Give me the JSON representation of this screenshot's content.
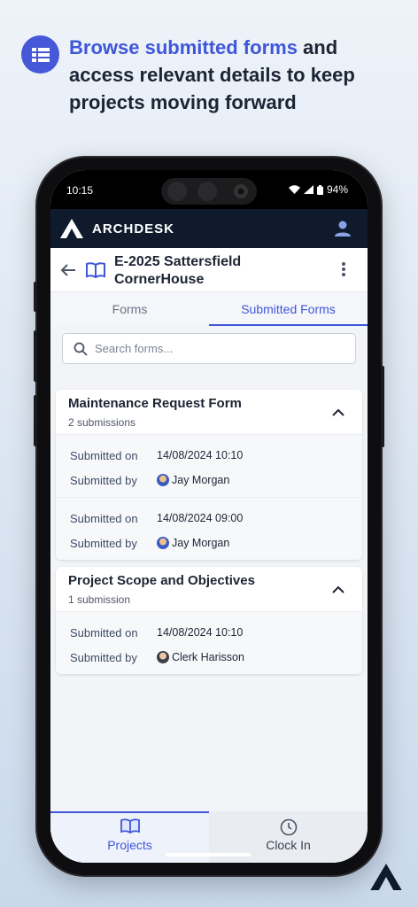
{
  "promo": {
    "headline_highlight": "Browse submitted forms",
    "headline_rest": " and access relevant details to keep projects moving forward",
    "icon": "list-icon"
  },
  "status_bar": {
    "time": "10:15",
    "battery": "94%"
  },
  "app": {
    "brand": "ARCHDESK"
  },
  "project": {
    "title_line1": "E-2025 Sattersfield",
    "title_line2": "CornerHouse"
  },
  "tabs": [
    {
      "label": "Forms",
      "active": false
    },
    {
      "label": "Submitted Forms",
      "active": true
    }
  ],
  "search": {
    "placeholder": "Search forms...",
    "value": ""
  },
  "forms": [
    {
      "title": "Maintenance Request Form",
      "count": "2 submissions",
      "submissions": [
        {
          "submitted_on_label": "Submitted on",
          "submitted_on": "14/08/2024 10:10",
          "submitted_by_label": "Submitted by",
          "submitted_by": "Jay Morgan"
        },
        {
          "submitted_on_label": "Submitted on",
          "submitted_on": "14/08/2024 09:00",
          "submitted_by_label": "Submitted by",
          "submitted_by": "Jay Morgan"
        }
      ]
    },
    {
      "title": "Project Scope and Objectives",
      "count": "1 submission",
      "submissions": [
        {
          "submitted_on_label": "Submitted on",
          "submitted_on": "14/08/2024 10:10",
          "submitted_by_label": "Submitted by",
          "submitted_by": "Clerk Harisson"
        }
      ]
    }
  ],
  "bottom_nav": [
    {
      "label": "Projects",
      "icon": "book-icon",
      "active": true
    },
    {
      "label": "Clock In",
      "icon": "clock-icon",
      "active": false
    }
  ],
  "colors": {
    "accent": "#3f56d8",
    "appbar": "#0f1b2d"
  }
}
